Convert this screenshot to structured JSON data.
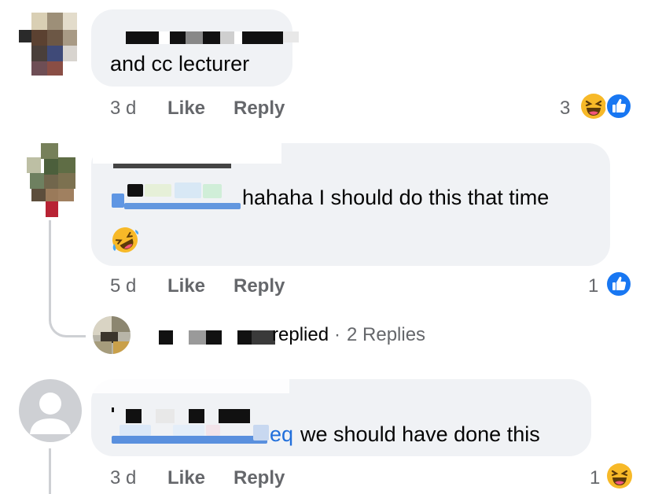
{
  "comments": [
    {
      "text": "and cc lecturer",
      "time": "3 d",
      "like_label": "Like",
      "reply_label": "Reply",
      "reaction_count": "3",
      "reactions": [
        "haha-icon",
        "like-icon"
      ]
    },
    {
      "text": "hahaha I should do this that time",
      "emoji": "rolling-laughing-emoji",
      "time": "5 d",
      "like_label": "Like",
      "reply_label": "Reply",
      "reaction_count": "1",
      "reactions": [
        "like-icon"
      ],
      "replies_summary": {
        "replied_text": "replied",
        "separator": "·",
        "replies_count": "2 Replies"
      }
    },
    {
      "mention_tail": "eq",
      "text": "we should have done this",
      "time": "3 d",
      "like_label": "Like",
      "reply_label": "Reply",
      "reaction_count": "1",
      "reactions": [
        "haha-icon"
      ]
    }
  ],
  "colors": {
    "bubble": "#f0f2f5",
    "meta": "#65676b",
    "mention": "#216fdb",
    "like_blue": "#1877f2",
    "haha_yellow": "#f7b928"
  }
}
